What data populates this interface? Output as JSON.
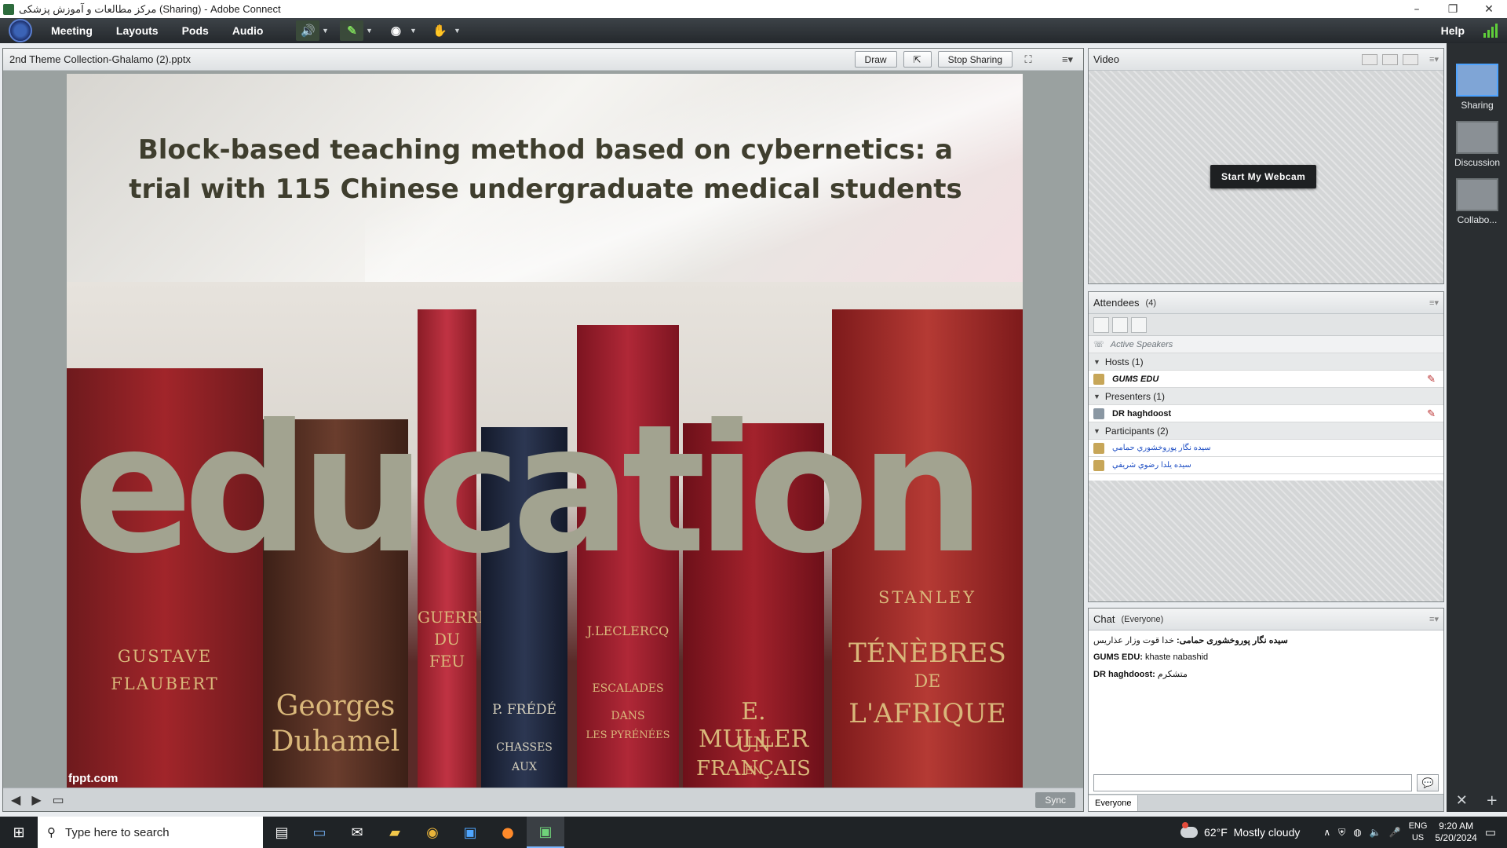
{
  "window": {
    "title": "مرکز مطالعات و آموزش پزشکی (Sharing) - Adobe Connect",
    "controls": [
      "–",
      "❐",
      "✕"
    ]
  },
  "menubar": {
    "items": [
      "Meeting",
      "Layouts",
      "Pods",
      "Audio"
    ],
    "help": "Help",
    "icons": [
      "speaker-icon",
      "microphone-icon",
      "webcam-icon",
      "raise-hand-icon"
    ]
  },
  "share_pod": {
    "file_name": "2nd Theme Collection-Ghalamo (2).pptx",
    "draw_label": "Draw",
    "stop_sharing_label": "Stop Sharing",
    "sync_label": "Sync"
  },
  "slide": {
    "title": "Block-based teaching method based on cybernetics: a trial with 115 Chinese undergraduate medical students",
    "big_word": "education",
    "watermark": "fppt.com",
    "book_spines": [
      {
        "lines": [
          "GUSTAVE",
          "FLAUBERT"
        ]
      },
      {
        "lines": [
          "Georges",
          "Duhamel"
        ]
      },
      {
        "lines": [
          "GUERRE",
          "DU",
          "FEU"
        ]
      },
      {
        "lines": [
          "P. FRÉDÉ",
          "CHASSES",
          "AUX"
        ]
      },
      {
        "lines": [
          "J.LECLERCQ",
          "ESCALADES",
          "DANS",
          "LES PYRÉNÉES"
        ]
      },
      {
        "lines": [
          "E. MULLER",
          "UN FRANÇAIS",
          "EN"
        ]
      },
      {
        "lines": [
          "STANLEY",
          "TÉNÈBRES",
          "DE",
          "L'AFRIQUE"
        ]
      }
    ]
  },
  "video_pod": {
    "title": "Video",
    "webcam_button": "Start My Webcam"
  },
  "attendees_pod": {
    "title": "Attendees",
    "count": "(4)",
    "active_speakers": "Active Speakers",
    "hosts_label": "Hosts (1)",
    "hosts": [
      "GUMS EDU"
    ],
    "presenters_label": "Presenters (1)",
    "presenters": [
      "DR haghdoost"
    ],
    "participants_label": "Participants (2)",
    "participants": [
      "سیده نگار پوروخشوري حمامي",
      "سيده يلدا رضوي شريفي"
    ]
  },
  "chat_pod": {
    "title": "Chat",
    "scope": "(Everyone)",
    "messages": [
      {
        "sender": "سیده نگار پوروخشوری حمامی:",
        "text": "خدا قوت وزار عذاریس"
      },
      {
        "sender": "GUMS EDU:",
        "text": "khaste nabashid"
      },
      {
        "sender": "DR haghdoost:",
        "text": "متشکرم"
      }
    ],
    "input_placeholder": "",
    "tab_everyone": "Everyone"
  },
  "layouts_bar": {
    "items": [
      "Sharing",
      "Discussion",
      "Collabo..."
    ]
  },
  "taskbar": {
    "search_placeholder": "Type here to search",
    "weather_temp": "62°F",
    "weather_text": "Mostly cloudy",
    "lang_top": "ENG",
    "lang_bottom": "US",
    "time": "9:20 AM",
    "date": "5/20/2024"
  }
}
